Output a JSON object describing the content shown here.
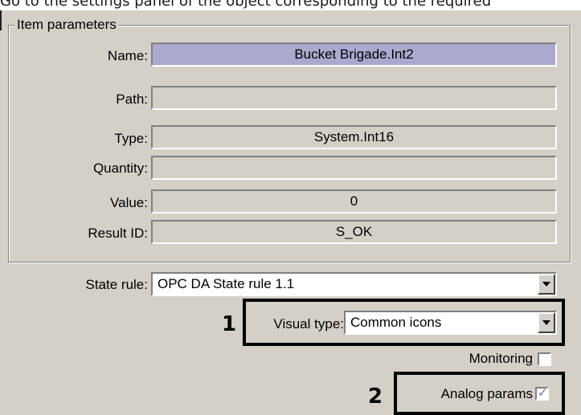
{
  "caption": "Go to the settings panel of the object corresponding to the required",
  "item_parameters": {
    "title": "Item parameters",
    "fields": [
      {
        "label": "Name:",
        "value": "Bucket Brigade.Int2"
      },
      {
        "label": "Path:",
        "value": ""
      },
      {
        "label": "Type:",
        "value": "System.Int16"
      },
      {
        "label": "Quantity:",
        "value": ""
      },
      {
        "label": "Value:",
        "value": "0"
      },
      {
        "label": "Result ID:",
        "value": "S_OK"
      }
    ]
  },
  "state_rule": {
    "label": "State rule:",
    "value": "OPC DA State rule 1.1"
  },
  "visual_type": {
    "label": "Visual type:",
    "value": "Common icons"
  },
  "monitoring": {
    "label": "Monitoring",
    "checked": false
  },
  "analog_params": {
    "label": "Analog params",
    "checked": true
  },
  "callouts": {
    "one": "1",
    "two": "2"
  },
  "colors": {
    "panel": "#d4d0c8",
    "name_highlight": "#aaa9cf",
    "check": "#5a6fb0"
  }
}
